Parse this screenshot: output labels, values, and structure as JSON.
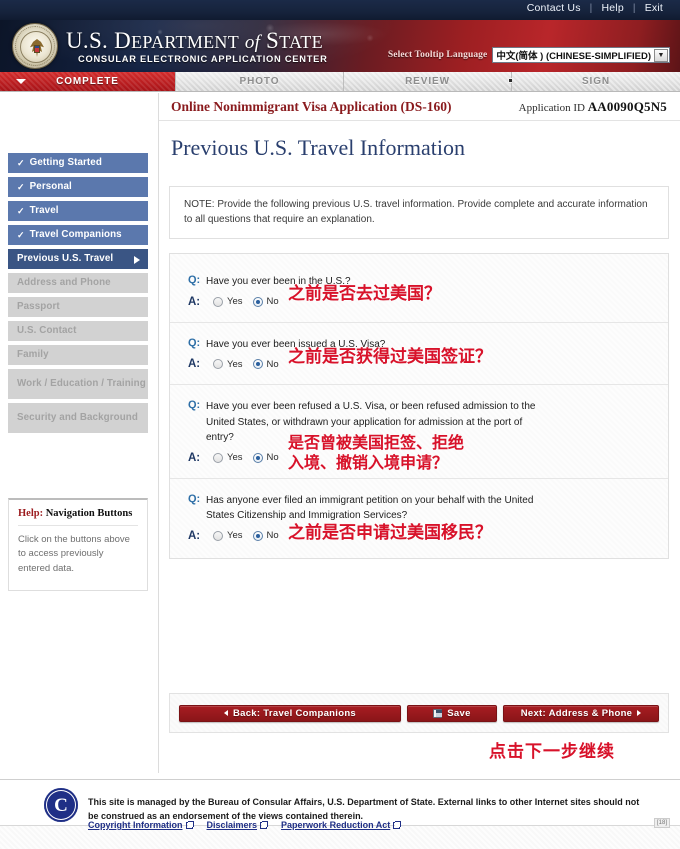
{
  "topbar": {
    "links": [
      "Contact Us",
      "Help",
      "Exit"
    ],
    "separator": "|"
  },
  "banner": {
    "seal_name": "us-department-of-state-seal",
    "title_part1": "U.S. D",
    "title_part2": "EPARTMENT",
    "title_of": "of",
    "title_part3": "S",
    "title_part4": "TATE",
    "subtitle": "CONSULAR ELECTRONIC APPLICATION CENTER",
    "language_label": "Select Tooltip Language",
    "language_value": "中文(简体 ) (CHINESE-SIMPLIFIED)"
  },
  "tabs": [
    {
      "label": "COMPLETE",
      "state": "active"
    },
    {
      "label": "PHOTO",
      "state": "inactive"
    },
    {
      "label": "REVIEW",
      "state": "inactive"
    },
    {
      "label": "SIGN",
      "state": "inactive"
    }
  ],
  "app_header": {
    "form_title": "Online Nonimmigrant Visa Application (DS-160)",
    "application_id_label": "Application ID",
    "application_id_value": "AA0090Q5N5"
  },
  "page_title": "Previous U.S. Travel Information",
  "note": "NOTE: Provide the following previous U.S. travel information. Provide complete and accurate information to all questions that require an explanation.",
  "sidebar": {
    "items": [
      {
        "label": "Getting Started",
        "state": "done",
        "check": "✓"
      },
      {
        "label": "Personal",
        "state": "done",
        "check": "✓"
      },
      {
        "label": "Travel",
        "state": "done",
        "check": "✓"
      },
      {
        "label": "Travel Companions",
        "state": "done",
        "check": "✓"
      },
      {
        "label": "Previous U.S. Travel",
        "state": "current",
        "check": ""
      },
      {
        "label": "Address and Phone",
        "state": "todo",
        "check": ""
      },
      {
        "label": "Passport",
        "state": "todo",
        "check": ""
      },
      {
        "label": "U.S. Contact",
        "state": "todo",
        "check": ""
      },
      {
        "label": "Family",
        "state": "todo",
        "check": ""
      },
      {
        "label": "Work / Education / Training",
        "state": "todo",
        "check": ""
      },
      {
        "label": "Security and Background",
        "state": "todo",
        "check": ""
      }
    ],
    "help": {
      "title_prefix": "Help:",
      "title_rest": " Navigation Buttons",
      "body": "Click on the buttons above to access previously entered data."
    }
  },
  "questions": [
    {
      "q_label": "Q:",
      "a_label": "A:",
      "question": "Have you ever been in the U.S.?",
      "yes_label": "Yes",
      "no_label": "No",
      "selected": "No",
      "annotation": "之前是否去过美国？"
    },
    {
      "q_label": "Q:",
      "a_label": "A:",
      "question": "Have you ever been issued a U.S. Visa?",
      "yes_label": "Yes",
      "no_label": "No",
      "selected": "No",
      "annotation": "之前是否获得过美国签证？"
    },
    {
      "q_label": "Q:",
      "a_label": "A:",
      "question": "Have you ever been refused a U.S. Visa, or been refused admission to the United States, or withdrawn your application for admission at the port of entry?",
      "yes_label": "Yes",
      "no_label": "No",
      "selected": "No",
      "annotation": "是否曾被美国拒签、拒绝\n入境、撤销入境申请？"
    },
    {
      "q_label": "Q:",
      "a_label": "A:",
      "question": "Has anyone ever filed an immigrant petition on your behalf with the United States Citizenship and Immigration Services?",
      "yes_label": "Yes",
      "no_label": "No",
      "selected": "No",
      "annotation": "之前是否申请过美国移民？"
    }
  ],
  "buttons": {
    "back": "Back: Travel Companions",
    "save": "Save",
    "next": "Next: Address & Phone",
    "next_annotation": "点击下一步继续"
  },
  "footer": {
    "seal_letter": "C",
    "text": "This site is managed by the Bureau of Consular Affairs, U.S. Department of State. External links to other Internet sites should not be construed as an endorsement of the views contained therein.",
    "links": [
      "Copyright Information",
      "Disclaimers",
      "Paperwork Reduction Act"
    ],
    "badge": "[18]"
  },
  "colors": {
    "brand_red": "#a81d22",
    "banner_navy": "#16233c",
    "nav_done": "#5b78ad",
    "nav_current": "#3a5584",
    "nav_todo": "#d2d2d2",
    "annotation_red": "#d8122a",
    "title_blue": "#2a3f6e",
    "link_blue": "#1f2f86"
  }
}
